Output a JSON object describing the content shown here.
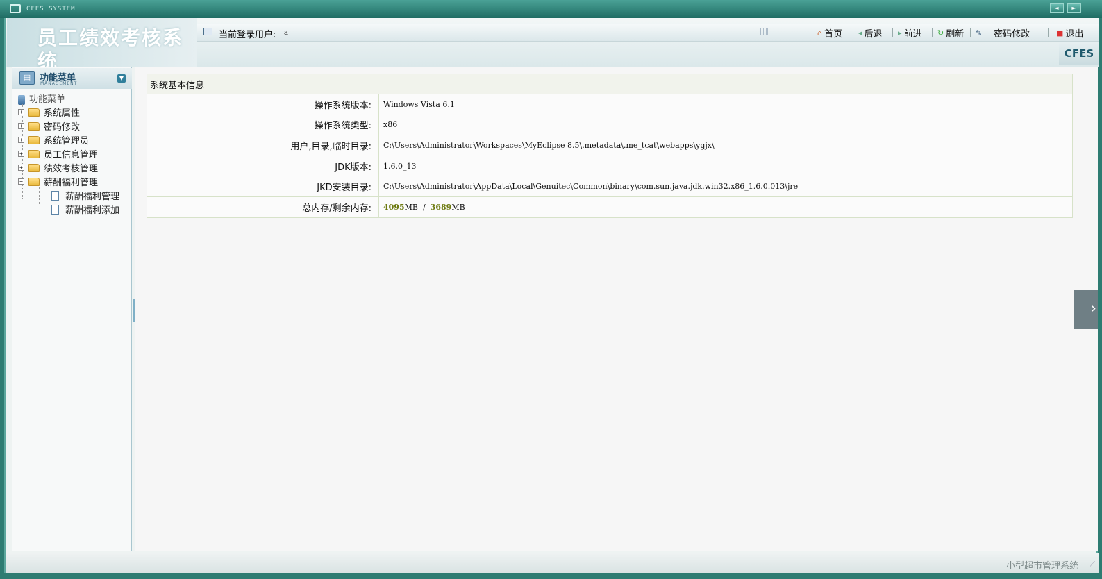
{
  "window": {
    "title": "CFES SYSTEM",
    "nav_prev": "◄",
    "nav_next": "►"
  },
  "header": {
    "logo_text": "员工绩效考核系统",
    "user_label": "当前登录用户:",
    "user_name": "a",
    "brand": "CFES",
    "toolbar": [
      {
        "label": "首页",
        "icon": "home-icon"
      },
      {
        "label": "后退",
        "icon": "back-icon"
      },
      {
        "label": "前进",
        "icon": "forward-icon"
      },
      {
        "label": "刷新",
        "icon": "refresh-icon"
      },
      {
        "label": "密码修改",
        "icon": "password-icon"
      },
      {
        "label": "退出",
        "icon": "exit-icon"
      }
    ]
  },
  "sidebar": {
    "title": "功能菜单",
    "subtitle": "MANAGEMENT",
    "root_label": "功能菜单",
    "items": [
      {
        "label": "系统属性",
        "expanded": false
      },
      {
        "label": "密码修改",
        "expanded": false
      },
      {
        "label": "系统管理员",
        "expanded": false
      },
      {
        "label": "员工信息管理",
        "expanded": false
      },
      {
        "label": "绩效考核管理",
        "expanded": false
      },
      {
        "label": "薪酬福利管理",
        "expanded": true
      }
    ],
    "children": [
      {
        "label": "薪酬福利管理"
      },
      {
        "label": "薪酬福利添加"
      }
    ]
  },
  "main": {
    "table_title": "系统基本信息",
    "rows": [
      {
        "label": "操作系统版本:",
        "value": "Windows Vista  6.1"
      },
      {
        "label": "操作系统类型:",
        "value": "x86"
      },
      {
        "label": "用户,目录,临时目录:",
        "value": "C:\\Users\\Administrator\\Workspaces\\MyEclipse 8.5\\.metadata\\.me_tcat\\webapps\\ygjx\\"
      },
      {
        "label": "JDK版本:",
        "value": "1.6.0_13"
      },
      {
        "label": "JKD安装目录:",
        "value": "C:\\Users\\Administrator\\AppData\\Local\\Genuitec\\Common\\binary\\com.sun.java.jdk.win32.x86_1.6.0.013\\jre"
      }
    ],
    "memory": {
      "label": "总内存/剩余内存:",
      "total": "4095",
      "free": "3689",
      "unit": "MB",
      "separator": "/"
    }
  },
  "footer": {
    "text": "小型超市管理系统"
  },
  "colors": {
    "frame": "#2e7c72",
    "accent": "#24506e",
    "memory": "#6d7a10"
  }
}
